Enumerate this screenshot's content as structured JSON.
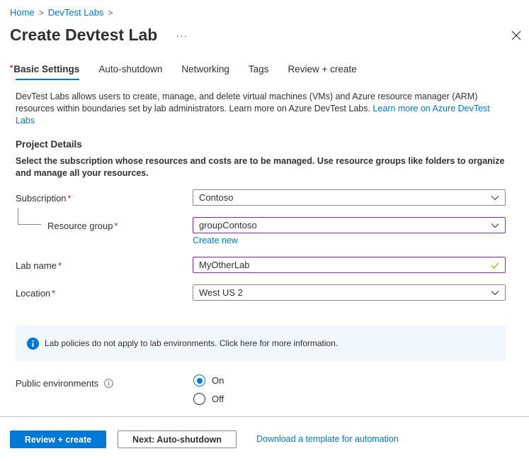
{
  "breadcrumb": [
    {
      "label": "Home"
    },
    {
      "label": "DevTest Labs"
    }
  ],
  "header": {
    "title": "Create Devtest Lab",
    "more_label": "···",
    "close_icon": "close-icon"
  },
  "tabs": [
    {
      "label": "Basic Settings",
      "required": "*",
      "active": true
    },
    {
      "label": "Auto-shutdown"
    },
    {
      "label": "Networking"
    },
    {
      "label": "Tags"
    },
    {
      "label": "Review + create"
    }
  ],
  "description": {
    "text": "DevTest Labs allows users to create, manage, and delete virtual machines (VMs) and Azure resource manager (ARM) resources within boundaries set by lab administrators. Learn more on Azure DevTest Labs. ",
    "link": "Learn more on Azure DevTest Labs"
  },
  "project_details": {
    "title": "Project Details",
    "description": "Select the subscription whose resources and costs are to be managed. Use resource groups like folders to organize and manage all your resources."
  },
  "form": {
    "required_mark": "*",
    "subscription": {
      "label": "Subscription",
      "value": "Contoso"
    },
    "resource_group": {
      "label": "Resource group",
      "value": "groupContoso",
      "create_new": "Create new"
    },
    "lab_name": {
      "label": "Lab name",
      "value": "MyOtherLab",
      "valid": true
    },
    "location": {
      "label": "Location",
      "value": "West US 2"
    }
  },
  "info_banner": {
    "icon": "info-icon",
    "text": "Lab policies do not apply to lab environments. Click here for more information."
  },
  "public_environments": {
    "label": "Public environments",
    "options": [
      {
        "label": "On",
        "checked": true
      },
      {
        "label": "Off",
        "checked": false
      }
    ]
  },
  "footer": {
    "review_create": "Review + create",
    "next": "Next: Auto-shutdown",
    "download": "Download a template for automation"
  },
  "colors": {
    "accent": "#0078d4",
    "required": "#a4262c",
    "focus_border": "#8a2da5",
    "valid_check": "#6bb700",
    "info_bg": "#eff6fc"
  }
}
